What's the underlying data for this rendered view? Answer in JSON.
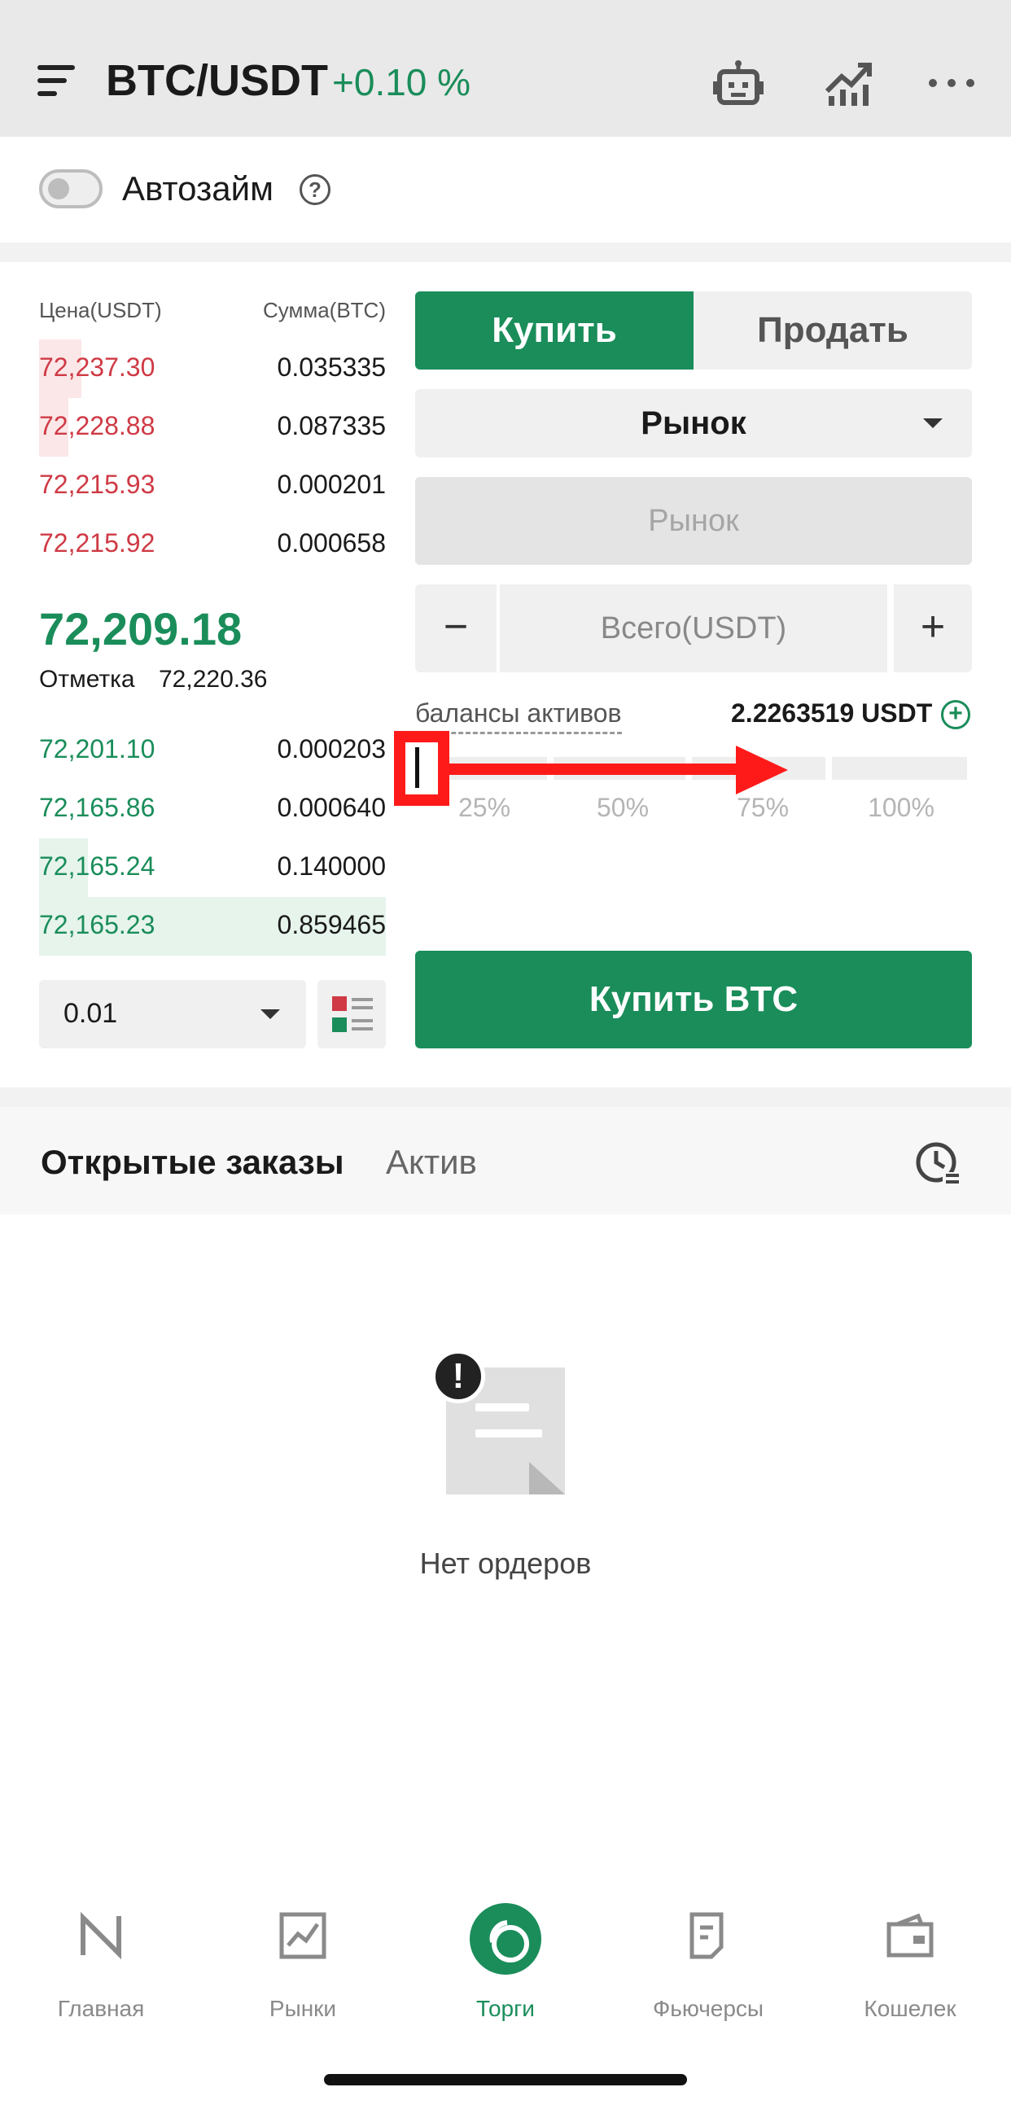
{
  "header": {
    "pair": "BTC/USDT",
    "change": "+0.10 %",
    "icons": [
      "menu-icon",
      "robot-icon",
      "chart-icon",
      "more-icon"
    ]
  },
  "autoloan": {
    "label": "Автозайм",
    "help": "?",
    "enabled": false
  },
  "orderbook": {
    "price_header": "Цена(USDT)",
    "amount_header": "Сумма(BTC)",
    "asks": [
      {
        "price": "72,237.30",
        "amount": "0.035335"
      },
      {
        "price": "72,228.88",
        "amount": "0.087335"
      },
      {
        "price": "72,215.93",
        "amount": "0.000201"
      },
      {
        "price": "72,215.92",
        "amount": "0.000658"
      }
    ],
    "last_price": "72,209.18",
    "mark_label": "Отметка",
    "mark_value": "72,220.36",
    "bids": [
      {
        "price": "72,201.10",
        "amount": "0.000203"
      },
      {
        "price": "72,165.86",
        "amount": "0.000640"
      },
      {
        "price": "72,165.24",
        "amount": "0.140000"
      },
      {
        "price": "72,165.23",
        "amount": "0.859465"
      }
    ],
    "precision": "0.01"
  },
  "trade": {
    "buy_tab": "Купить",
    "sell_tab": "Продать",
    "order_type": "Рынок",
    "price_placeholder": "Рынок",
    "minus": "−",
    "total_placeholder": "Всего(USDT)",
    "plus": "+",
    "balance_label": "балансы активов",
    "balance_value": "2.2263519 USDT",
    "slider_ticks": [
      "25%",
      "50%",
      "75%",
      "100%"
    ],
    "slider_value_percent": 0,
    "buy_button": "Купить BTC"
  },
  "orders": {
    "tab_open": "Открытые заказы",
    "tab_assets": "Актив",
    "empty_text": "Нет ордеров"
  },
  "bottom_nav": [
    {
      "label": "Главная",
      "icon": "home-icon"
    },
    {
      "label": "Рынки",
      "icon": "markets-icon"
    },
    {
      "label": "Торги",
      "icon": "trade-icon",
      "active": true
    },
    {
      "label": "Фьючерсы",
      "icon": "futures-icon"
    },
    {
      "label": "Кошелек",
      "icon": "wallet-icon"
    }
  ],
  "colors": {
    "accent": "#1a8d5a",
    "ask": "#cf3a45",
    "annotation": "#ff1a1a"
  }
}
